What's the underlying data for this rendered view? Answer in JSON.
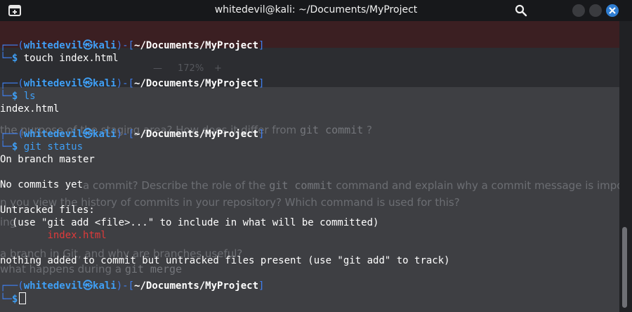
{
  "window": {
    "title": "whitedevil@kali: ~/Documents/MyProject"
  },
  "colors": {
    "prompt_frame": "#3f7ff0",
    "user_host": "#3f9ff5",
    "untracked_file": "#e03a3a",
    "close_button": "#2f7dd1"
  },
  "icons": {
    "new_tab": "new-tab-icon",
    "search": "search-icon",
    "minimize": "minimize-icon",
    "maximize": "maximize-icon",
    "close": "close-icon"
  },
  "background_doc": {
    "zoom": "172%",
    "q1": "the purpose of the staging area? How does it differ from",
    "q1_code": "git commit",
    "q1_end": "?",
    "q2a": "a commit? Describe the role of the",
    "q2_code": "git commit",
    "q2b": "command and explain why a commit message is important.",
    "q3": "n you view the history of commits in your repository? Which command is used for this?",
    "q4": "ing",
    "q5": "a branch in Git, and why are branches useful?",
    "q6": "what happens during a",
    "q6_code": "git merge"
  },
  "terminal": {
    "user": "whitedevil",
    "host": "kali",
    "cwd": "~/Documents/MyProject",
    "at": "㉿",
    "blocks": [
      {
        "command": "touch index.html",
        "output": []
      },
      {
        "command": "ls",
        "output": [
          "index.html"
        ]
      },
      {
        "command": "git status",
        "output": [
          "On branch master",
          "",
          "No commits yet",
          "",
          "Untracked files:",
          "  (use \"git add <file>...\" to include in what will be committed)",
          "index.html",
          "",
          "nothing added to commit but untracked files present (use \"git add\" to track)"
        ]
      }
    ]
  }
}
